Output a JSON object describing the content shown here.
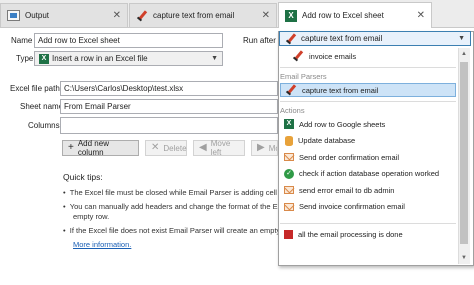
{
  "tabs": [
    {
      "label": "Output",
      "icon": "output-icon"
    },
    {
      "label": "capture text from email",
      "icon": "pen-icon"
    },
    {
      "label": "Add row to Excel sheet",
      "icon": "excel-icon"
    }
  ],
  "form": {
    "name_label": "Name",
    "name_value": "Add row to Excel sheet",
    "type_label": "Type",
    "type_value": "Insert a row in an Excel file",
    "run_after_label": "Run after",
    "run_after_value": "capture text from email",
    "excel_file_path_label": "Excel file path",
    "excel_file_path_value": "C:\\Users\\Carlos\\Desktop\\test.xlsx",
    "sheet_name_label": "Sheet name",
    "sheet_name_value": "From Email Parser",
    "columns_label": "Columns",
    "columns_value": ""
  },
  "toolbar": {
    "add_new_column": "Add new column",
    "delete": "Delete",
    "move_left": "Move left",
    "move_right": "Mov"
  },
  "tips": {
    "heading": "Quick tips:",
    "items": [
      "The Excel file must be closed while Email Parser is adding cell",
      "You can manually add headers and change the format of the E",
      "empty row.",
      "If the Excel file does not exist Email Parser will create an empty"
    ],
    "more_info": "More information."
  },
  "popup": {
    "selected": "capture text from email",
    "top_item": "invoice emails",
    "section_parsers": "Email Parsers",
    "parser_item": "capture text from email",
    "section_actions": "Actions",
    "actions": [
      {
        "label": "Add row to Google sheets",
        "icon": "sheet-icon"
      },
      {
        "label": "Update database",
        "icon": "database-icon"
      },
      {
        "label": "Send order confirmation email",
        "icon": "envelope-icon"
      },
      {
        "label": "check if action database operation worked",
        "icon": "check-icon"
      },
      {
        "label": "send error email to db admin",
        "icon": "envelope-icon"
      },
      {
        "label": "Send invoice confirmation email",
        "icon": "envelope-icon"
      }
    ],
    "final_item": "all the email processing is done"
  },
  "colors": {
    "selection": "#cde3f7",
    "excel_green": "#1e7145",
    "accent_blue": "#3c7fb1"
  }
}
